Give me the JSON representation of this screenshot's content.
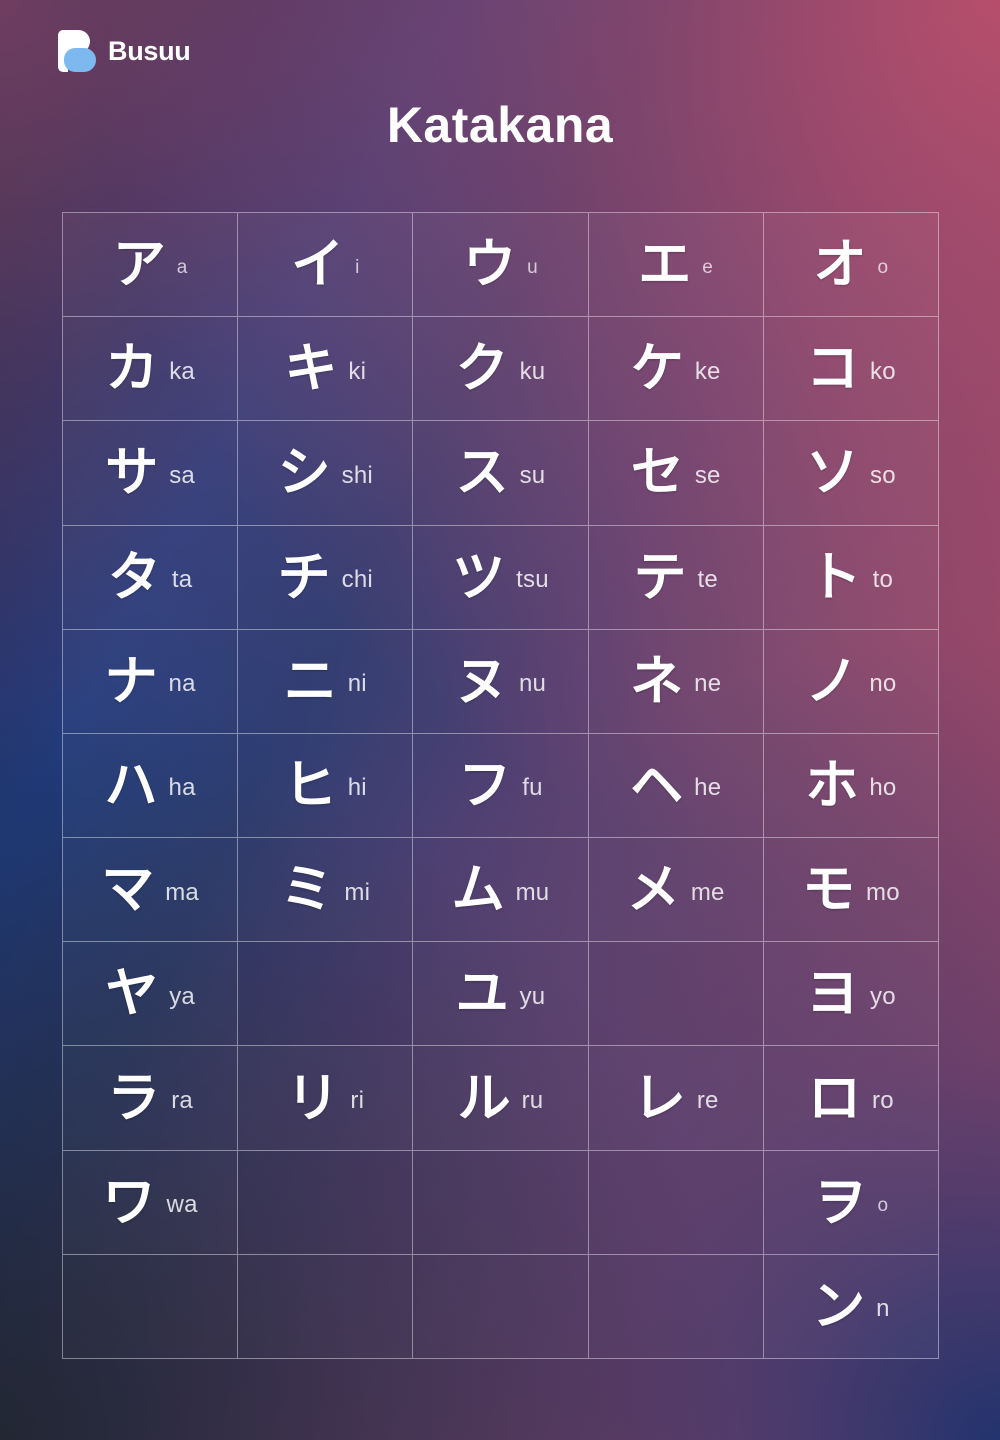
{
  "brand": {
    "name": "Busuu",
    "mark_icon": "busuu-b-logo-icon",
    "mark_colors": {
      "top": "#ffffff",
      "bottom": "#7db8ef"
    }
  },
  "header": {
    "title": "Katakana"
  },
  "theme": {
    "gradient_top_left": "#7c4068",
    "gradient_top_right": "#b74c68",
    "gradient_bottom_left": "#272d37",
    "gradient_bottom_right": "#133570",
    "text_color": "#ffffff",
    "romaji_color": "rgba(255,255,255,0.82)",
    "grid_line_color": "rgba(255,255,255,0.42)"
  },
  "chart_data": {
    "type": "table",
    "title": "Katakana",
    "columns": 5,
    "rows": 11,
    "column_vowels": [
      "a",
      "i",
      "u",
      "e",
      "o"
    ],
    "row_consonants": [
      "",
      "k",
      "s",
      "t",
      "n",
      "h",
      "m",
      "y",
      "r",
      "w",
      "n"
    ],
    "cells": [
      [
        {
          "kana": "ア",
          "romaji": "a",
          "small": true
        },
        {
          "kana": "イ",
          "romaji": "i",
          "small": true
        },
        {
          "kana": "ウ",
          "romaji": "u",
          "small": true
        },
        {
          "kana": "エ",
          "romaji": "e",
          "small": true
        },
        {
          "kana": "オ",
          "romaji": "o",
          "small": true
        }
      ],
      [
        {
          "kana": "カ",
          "romaji": "ka",
          "small": false
        },
        {
          "kana": "キ",
          "romaji": "ki",
          "small": false
        },
        {
          "kana": "ク",
          "romaji": "ku",
          "small": false
        },
        {
          "kana": "ケ",
          "romaji": "ke",
          "small": false
        },
        {
          "kana": "コ",
          "romaji": "ko",
          "small": false
        }
      ],
      [
        {
          "kana": "サ",
          "romaji": "sa",
          "small": false
        },
        {
          "kana": "シ",
          "romaji": "shi",
          "small": false
        },
        {
          "kana": "ス",
          "romaji": "su",
          "small": false
        },
        {
          "kana": "セ",
          "romaji": "se",
          "small": false
        },
        {
          "kana": "ソ",
          "romaji": "so",
          "small": false
        }
      ],
      [
        {
          "kana": "タ",
          "romaji": "ta",
          "small": false
        },
        {
          "kana": "チ",
          "romaji": "chi",
          "small": false
        },
        {
          "kana": "ツ",
          "romaji": "tsu",
          "small": false
        },
        {
          "kana": "テ",
          "romaji": "te",
          "small": false
        },
        {
          "kana": "ト",
          "romaji": "to",
          "small": false
        }
      ],
      [
        {
          "kana": "ナ",
          "romaji": "na",
          "small": false
        },
        {
          "kana": "ニ",
          "romaji": "ni",
          "small": false
        },
        {
          "kana": "ヌ",
          "romaji": "nu",
          "small": false
        },
        {
          "kana": "ネ",
          "romaji": "ne",
          "small": false
        },
        {
          "kana": "ノ",
          "romaji": "no",
          "small": false
        }
      ],
      [
        {
          "kana": "ハ",
          "romaji": "ha",
          "small": false
        },
        {
          "kana": "ヒ",
          "romaji": "hi",
          "small": false
        },
        {
          "kana": "フ",
          "romaji": "fu",
          "small": false
        },
        {
          "kana": "ヘ",
          "romaji": "he",
          "small": false
        },
        {
          "kana": "ホ",
          "romaji": "ho",
          "small": false
        }
      ],
      [
        {
          "kana": "マ",
          "romaji": "ma",
          "small": false
        },
        {
          "kana": "ミ",
          "romaji": "mi",
          "small": false
        },
        {
          "kana": "ム",
          "romaji": "mu",
          "small": false
        },
        {
          "kana": "メ",
          "romaji": "me",
          "small": false
        },
        {
          "kana": "モ",
          "romaji": "mo",
          "small": false
        }
      ],
      [
        {
          "kana": "ヤ",
          "romaji": "ya",
          "small": false
        },
        {
          "kana": "",
          "romaji": "",
          "small": false
        },
        {
          "kana": "ユ",
          "romaji": "yu",
          "small": false
        },
        {
          "kana": "",
          "romaji": "",
          "small": false
        },
        {
          "kana": "ヨ",
          "romaji": "yo",
          "small": false
        }
      ],
      [
        {
          "kana": "ラ",
          "romaji": "ra",
          "small": false
        },
        {
          "kana": "リ",
          "romaji": "ri",
          "small": false
        },
        {
          "kana": "ル",
          "romaji": "ru",
          "small": false
        },
        {
          "kana": "レ",
          "romaji": "re",
          "small": false
        },
        {
          "kana": "ロ",
          "romaji": "ro",
          "small": false
        }
      ],
      [
        {
          "kana": "ワ",
          "romaji": "wa",
          "small": false
        },
        {
          "kana": "",
          "romaji": "",
          "small": false
        },
        {
          "kana": "",
          "romaji": "",
          "small": false
        },
        {
          "kana": "",
          "romaji": "",
          "small": false
        },
        {
          "kana": "ヲ",
          "romaji": "o",
          "small": true
        }
      ],
      [
        {
          "kana": "",
          "romaji": "",
          "small": false
        },
        {
          "kana": "",
          "romaji": "",
          "small": false
        },
        {
          "kana": "",
          "romaji": "",
          "small": false
        },
        {
          "kana": "",
          "romaji": "",
          "small": false
        },
        {
          "kana": "ン",
          "romaji": "n",
          "small": false
        }
      ]
    ]
  }
}
